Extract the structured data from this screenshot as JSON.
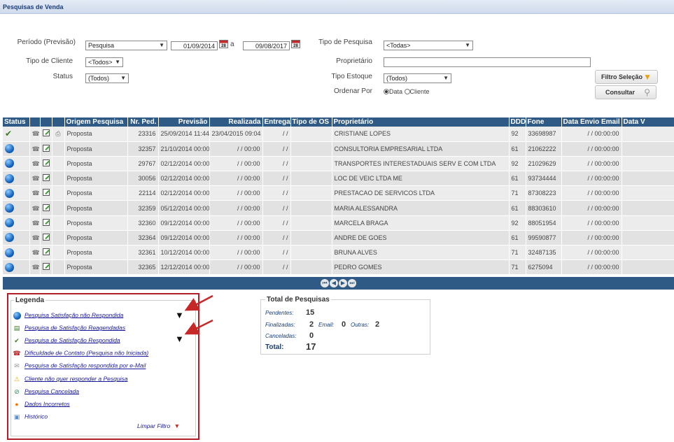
{
  "title": "Pesquisas de Venda",
  "filters": {
    "periodo_label": "Período (Previsão)",
    "periodo_value": "Pesquisa",
    "date_from": "01/09/2014",
    "date_sep": "a",
    "date_to": "09/08/2017",
    "cal_icon_text": "28",
    "tipo_cliente_label": "Tipo de Cliente",
    "tipo_cliente_value": "<Todos>",
    "status_label": "Status",
    "status_value": "(Todos)",
    "tipo_pesquisa_label": "Tipo de Pesquisa",
    "tipo_pesquisa_value": "<Todas>",
    "proprietario_label": "Proprietário",
    "proprietario_value": "",
    "tipo_estoque_label": "Tipo Estoque",
    "tipo_estoque_value": "(Todos)",
    "ordenar_label": "Ordenar Por",
    "ordenar_opt1": "Data",
    "ordenar_opt2": "Cliente",
    "filtro_button": "Filtro Seleção",
    "consultar_button": "Consultar"
  },
  "table": {
    "headers": [
      "Status",
      "",
      "",
      "",
      "Origem Pesquisa",
      "Nr. Ped.",
      "Previsão",
      "Realizada",
      "Entrega",
      "Tipo de OS",
      "Proprietário",
      "DDD",
      "Fone",
      "Data Envio Email",
      "Data V"
    ],
    "rows": [
      {
        "status": "check",
        "origem": "Proposta",
        "nr": "23316",
        "prev": "25/09/2014 11:44",
        "real": "23/04/2015 09:04",
        "entrega": "/ /",
        "tipo_os": "",
        "prop": "CRISTIANE LOPES",
        "ddd": "92",
        "fone": "33698987",
        "envio": "/ / 00:00:00",
        "extra": true
      },
      {
        "status": "blue",
        "origem": "Proposta",
        "nr": "32357",
        "prev": "21/10/2014 00:00",
        "real": "/ / 00:00",
        "entrega": "/ /",
        "tipo_os": "",
        "prop": "CONSULTORIA EMPRESARIAL LTDA",
        "ddd": "61",
        "fone": "21062222",
        "envio": "/ / 00:00:00",
        "extra": false
      },
      {
        "status": "blue",
        "origem": "Proposta",
        "nr": "29767",
        "prev": "02/12/2014 00:00",
        "real": "/ / 00:00",
        "entrega": "/ /",
        "tipo_os": "",
        "prop": "TRANSPORTES INTERESTADUAIS SERV E COM LTDA",
        "ddd": "92",
        "fone": "21029629",
        "envio": "/ / 00:00:00",
        "extra": false
      },
      {
        "status": "blue",
        "origem": "Proposta",
        "nr": "30056",
        "prev": "02/12/2014 00:00",
        "real": "/ / 00:00",
        "entrega": "/ /",
        "tipo_os": "",
        "prop": "LOC DE VEIC LTDA ME",
        "ddd": "61",
        "fone": "93734444",
        "envio": "/ / 00:00:00",
        "extra": false
      },
      {
        "status": "blue",
        "origem": "Proposta",
        "nr": "22114",
        "prev": "02/12/2014 00:00",
        "real": "/ / 00:00",
        "entrega": "/ /",
        "tipo_os": "",
        "prop": "PRESTACAO DE SERVICOS LTDA",
        "ddd": "71",
        "fone": "87308223",
        "envio": "/ / 00:00:00",
        "extra": false
      },
      {
        "status": "blue",
        "origem": "Proposta",
        "nr": "32359",
        "prev": "05/12/2014 00:00",
        "real": "/ / 00:00",
        "entrega": "/ /",
        "tipo_os": "",
        "prop": "MARIA ALESSANDRA",
        "ddd": "61",
        "fone": "88303610",
        "envio": "/ / 00:00:00",
        "extra": false
      },
      {
        "status": "blue",
        "origem": "Proposta",
        "nr": "32360",
        "prev": "09/12/2014 00:00",
        "real": "/ / 00:00",
        "entrega": "/ /",
        "tipo_os": "",
        "prop": "MARCELA BRAGA",
        "ddd": "92",
        "fone": "88051954",
        "envio": "/ / 00:00:00",
        "extra": false
      },
      {
        "status": "blue",
        "origem": "Proposta",
        "nr": "32364",
        "prev": "09/12/2014 00:00",
        "real": "/ / 00:00",
        "entrega": "/ /",
        "tipo_os": "",
        "prop": "ANDRE DE GOES",
        "ddd": "61",
        "fone": "99590877",
        "envio": "/ / 00:00:00",
        "extra": false
      },
      {
        "status": "blue",
        "origem": "Proposta",
        "nr": "32361",
        "prev": "10/12/2014 00:00",
        "real": "/ / 00:00",
        "entrega": "/ /",
        "tipo_os": "",
        "prop": "BRUNA ALVES",
        "ddd": "71",
        "fone": "32487135",
        "envio": "/ / 00:00:00",
        "extra": false
      },
      {
        "status": "blue",
        "origem": "Proposta",
        "nr": "32365",
        "prev": "12/12/2014 00:00",
        "real": "/ / 00:00",
        "entrega": "/ /",
        "tipo_os": "",
        "prop": "PEDRO GOMES",
        "ddd": "71",
        "fone": "6275094",
        "envio": "/ / 00:00:00",
        "extra": false
      }
    ]
  },
  "pager": [
    "first",
    "prev",
    "next",
    "last"
  ],
  "legend": {
    "title": "Legenda",
    "items": [
      {
        "label": "Pesquisa Satisfação não Respondida",
        "icon": "blue-circle-icon"
      },
      {
        "label": "Pesquisa de Satisfação Reagendadas",
        "icon": "calendar-icon"
      },
      {
        "label": "Pesquisa de Satisfação Respondida",
        "icon": "check-icon"
      },
      {
        "label": "Dificuldade de Contato (Pesquisa não Iniciada)",
        "icon": "phone-icon"
      },
      {
        "label": "Pesquisa de Satisfação respondida por e-Mail",
        "icon": "mail-icon"
      },
      {
        "label": "Cliente não quer responder a Pesquisa",
        "icon": "warning-icon"
      },
      {
        "label": "Pesquisa Cancelada",
        "icon": "cancel-icon"
      },
      {
        "label": "Dados Incorretos",
        "icon": "error-icon"
      },
      {
        "label": "Histórico",
        "icon": "history-icon"
      }
    ],
    "limpar": "Limpar Filtro"
  },
  "totals": {
    "title": "Total de Pesquisas",
    "pendentes_label": "Pendentes:",
    "pendentes": "15",
    "finalizadas_label": "Finalizadas:",
    "finalizadas": "2",
    "email_label": "Email:",
    "email": "0",
    "outras_label": "Outras:",
    "outras": "2",
    "canceladas_label": "Canceladas:",
    "canceladas": "0",
    "total_label": "Total:",
    "total": "17"
  }
}
